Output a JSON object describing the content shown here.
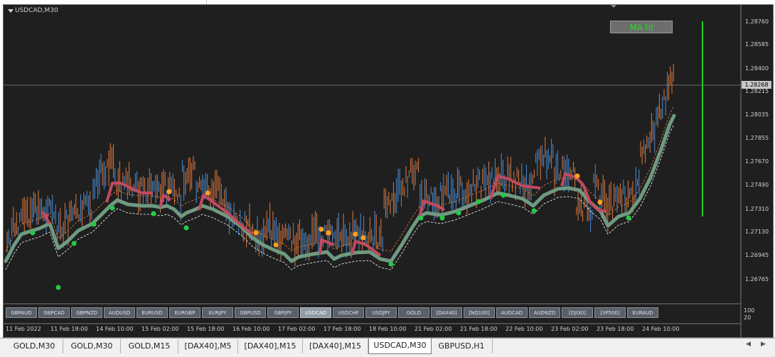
{
  "window": {
    "title": "USDCAD,M30"
  },
  "indicator_button": {
    "label": "MA hl"
  },
  "price_axis": {
    "labels": [
      "1.28760",
      "1.28585",
      "1.28400",
      "1.28215",
      "1.28035",
      "1.27855",
      "1.27670",
      "1.27490",
      "1.27310",
      "1.27130",
      "1.26945",
      "1.26765"
    ],
    "current_price": "1.28268"
  },
  "volume_axis": {
    "labels": [
      "100",
      "20"
    ]
  },
  "time_axis": {
    "labels": [
      "11 Feb 2022",
      "11 Feb 18:00",
      "14 Feb 10:00",
      "15 Feb 02:00",
      "15 Feb 18:00",
      "16 Feb 10:00",
      "17 Feb 02:00",
      "17 Feb 18:00",
      "18 Feb 10:00",
      "21 Feb 02:00",
      "21 Feb 18:00",
      "22 Feb 10:00",
      "23 Feb 02:00",
      "23 Feb 18:00",
      "24 Feb 10:00"
    ]
  },
  "symbols": [
    {
      "label": "GBPAUD",
      "active": false
    },
    {
      "label": "GBPCAD",
      "active": false
    },
    {
      "label": "GBPNZD",
      "active": false
    },
    {
      "label": "AUDUSD",
      "active": false
    },
    {
      "label": "EURUSD",
      "active": false
    },
    {
      "label": "EURGBP",
      "active": false
    },
    {
      "label": "EURJPY",
      "active": false
    },
    {
      "label": "GBPUSD",
      "active": false
    },
    {
      "label": "GBPJPY",
      "active": false
    },
    {
      "label": "USDCAD",
      "active": true
    },
    {
      "label": "USDCHF",
      "active": false
    },
    {
      "label": "USDJPY",
      "active": false
    },
    {
      "label": "GOLD",
      "active": false
    },
    {
      "label": "[DAX40]",
      "active": false
    },
    {
      "label": "[NQ100]",
      "active": false
    },
    {
      "label": "AUDCAD",
      "active": false
    },
    {
      "label": "AUDNZD",
      "active": false
    },
    {
      "label": "[DJI30]",
      "active": false
    },
    {
      "label": "[SP500]",
      "active": false
    },
    {
      "label": "EURAUD",
      "active": false
    }
  ],
  "tabs": [
    {
      "label": "GOLD,M30",
      "active": false
    },
    {
      "label": "GOLD,M30",
      "active": false
    },
    {
      "label": "GOLD,M15",
      "active": false
    },
    {
      "label": "[DAX40],M5",
      "active": false
    },
    {
      "label": "[DAX40],M15",
      "active": false
    },
    {
      "label": "[DAX40],M15",
      "active": false
    },
    {
      "label": "USDCAD,M30",
      "active": true
    },
    {
      "label": "GBPUSD,H1",
      "active": false
    }
  ],
  "colors": {
    "background": "#1f1f1f",
    "bull_candle": "#4a90d9",
    "bear_candle": "#e07a40",
    "ma_trend": "#6f9a80",
    "ma_high": "#c04a60",
    "dot_green": "#22cc44",
    "dot_orange": "#ffa020",
    "signal_bar": "#22cc22"
  },
  "icons": {
    "title_menu": "triangle-down-icon",
    "tab_left": "arrow-left-icon",
    "tab_right": "arrow-right-icon"
  }
}
